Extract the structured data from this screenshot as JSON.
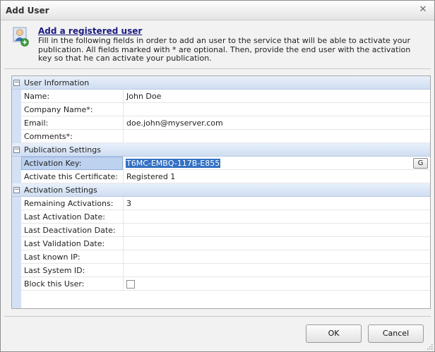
{
  "window": {
    "title": "Add User",
    "close_glyph": "✕"
  },
  "header": {
    "icon": "user-add-icon",
    "link": "Add a registered user",
    "description": "Fill in the following fields in order to add an user to the service that will be able to activate your publication. All fields marked with * are optional. Then, provide the end user with the activation key so that he can activate your publication."
  },
  "grid": {
    "user_information": {
      "label": "User Information",
      "toggle": "−",
      "name_label": "Name:",
      "name_value": "John Doe",
      "company_label": "Company Name*:",
      "company_value": "",
      "email_label": "Email:",
      "email_value": "doe.john@myserver.com",
      "comments_label": "Comments*:",
      "comments_value": ""
    },
    "publication_settings": {
      "label": "Publication Settings",
      "toggle": "−",
      "key_label": "Activation Key:",
      "key_value": "T6MC-EMBQ-117B-E855",
      "generate_button": "G",
      "certificate_label": "Activate this Certificate:",
      "certificate_value": "Registered 1"
    },
    "activation_settings": {
      "label": "Activation Settings",
      "toggle": "−",
      "remaining_label": "Remaining Activations:",
      "remaining_value": "3",
      "last_activation_label": "Last Activation Date:",
      "last_activation_value": "",
      "last_deactivation_label": "Last Deactivation Date:",
      "last_deactivation_value": "",
      "last_validation_label": "Last Validation Date:",
      "last_validation_value": "",
      "last_ip_label": "Last known IP:",
      "last_ip_value": "",
      "last_system_label": "Last System ID:",
      "last_system_value": "",
      "block_label": "Block this User:",
      "block_checked": false
    }
  },
  "footer": {
    "ok": "OK",
    "cancel": "Cancel"
  },
  "colors": {
    "accent": "#3471c3",
    "category": "#d0def2",
    "gutter": "#d4e1f5"
  }
}
